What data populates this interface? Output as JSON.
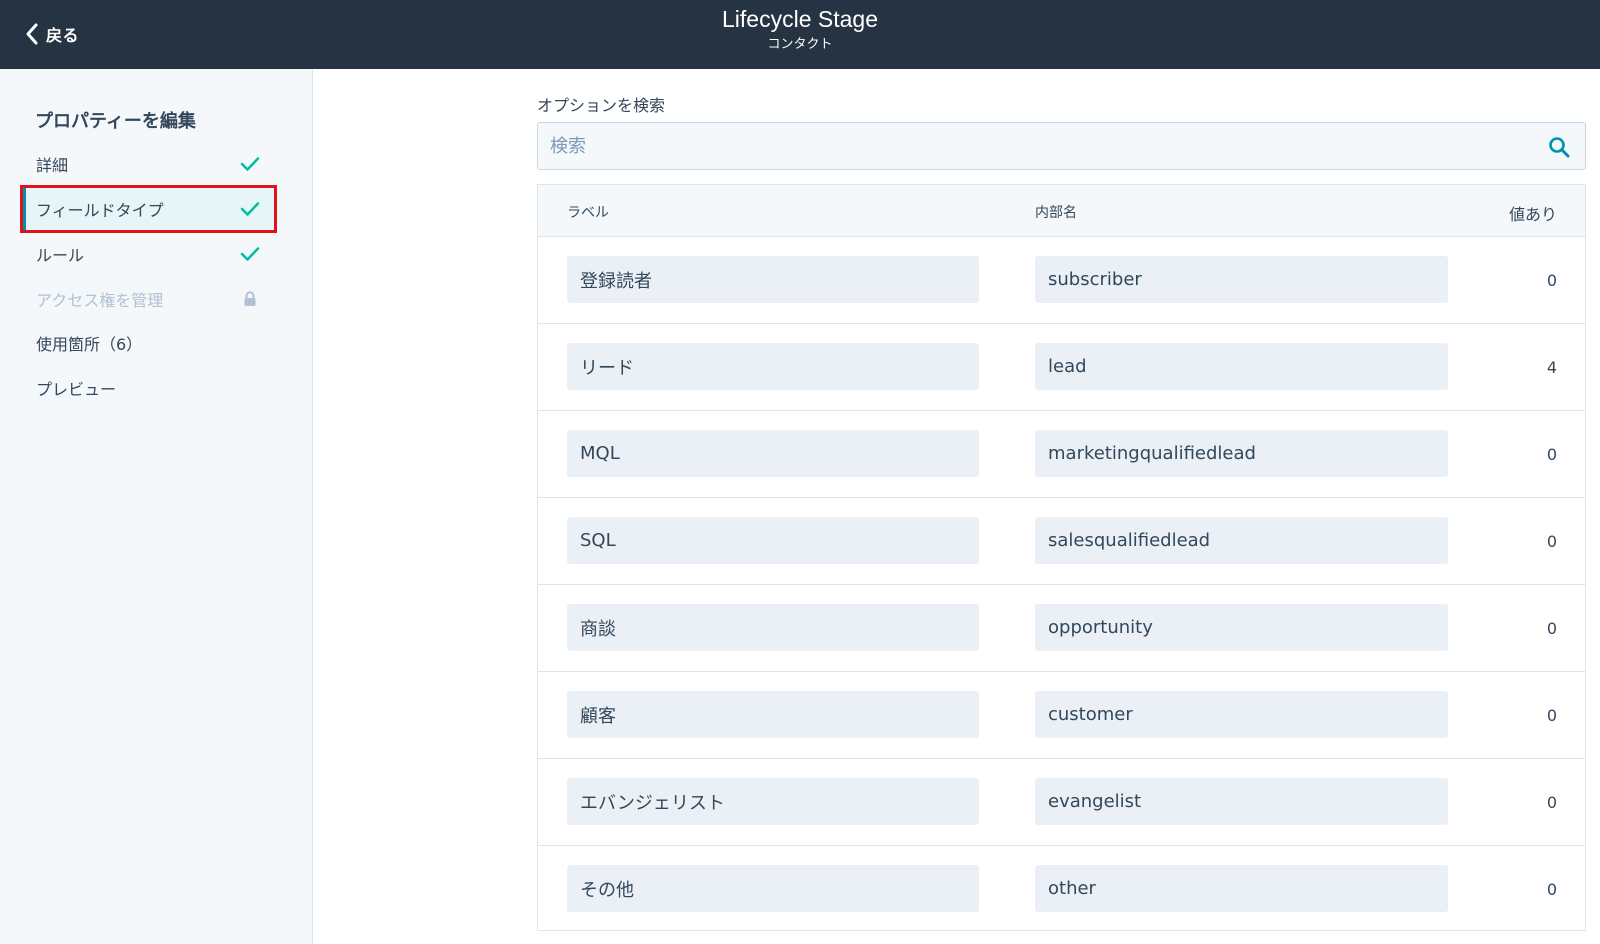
{
  "header": {
    "back_label": "戻る",
    "title": "Lifecycle Stage",
    "subtitle": "コンタクト"
  },
  "sidebar": {
    "heading": "プロパティーを編集",
    "items": [
      {
        "label": "詳細",
        "status": "check"
      },
      {
        "label": "フィールドタイプ",
        "status": "check",
        "active": true
      },
      {
        "label": "ルール",
        "status": "check"
      },
      {
        "label": "アクセス権を管理",
        "status": "lock",
        "disabled": true
      },
      {
        "label": "使用箇所（6）",
        "status": ""
      },
      {
        "label": "プレビュー",
        "status": ""
      }
    ]
  },
  "search": {
    "label": "オプションを検索",
    "placeholder": "検索"
  },
  "table": {
    "headers": {
      "label": "ラベル",
      "internal": "内部名",
      "count": "値あり"
    },
    "rows": [
      {
        "label": "登録読者",
        "internal": "subscriber",
        "count": "0"
      },
      {
        "label": "リード",
        "internal": "lead",
        "count": "4"
      },
      {
        "label": "MQL",
        "internal": "marketingqualifiedlead",
        "count": "0"
      },
      {
        "label": "SQL",
        "internal": "salesqualifiedlead",
        "count": "0"
      },
      {
        "label": "商談",
        "internal": "opportunity",
        "count": "0"
      },
      {
        "label": "顧客",
        "internal": "customer",
        "count": "0"
      },
      {
        "label": "エバンジェリスト",
        "internal": "evangelist",
        "count": "0"
      },
      {
        "label": "その他",
        "internal": "other",
        "count": "0"
      }
    ]
  },
  "colors": {
    "header_bg": "#253342",
    "accent_teal": "#00bda5",
    "highlight_red": "#e0131a",
    "sidebar_bg": "#f5f8fa",
    "input_bg": "#eaf0f6"
  }
}
